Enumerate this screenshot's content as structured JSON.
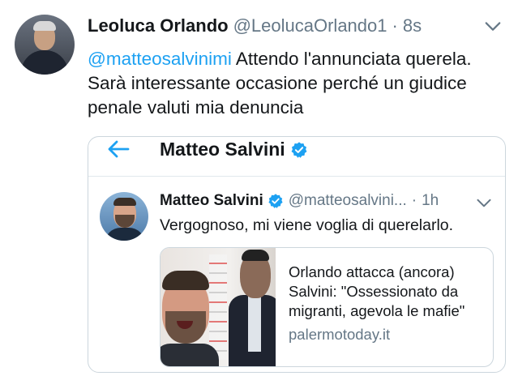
{
  "tweet": {
    "author_name": "Leoluca Orlando",
    "author_handle": "@LeolucaOrlando1",
    "separator": "·",
    "time": "8s",
    "mention": "@matteosalvinimi",
    "text": " Attendo l'annunciata querela. Sarà interessante occasione perché un giudice penale valuti mia denuncia"
  },
  "quoted_profile": {
    "title": "Matteo Salvini"
  },
  "quoted_tweet": {
    "author_name": "Matteo Salvini",
    "author_handle": "@matteosalvini...",
    "separator": "·",
    "time": "1h",
    "text": "Vergognoso, mi viene voglia di querelarlo."
  },
  "link_card": {
    "title": "Orlando attacca (ancora) Salvini: \"Ossessionato da migranti, agevola le mafie\"",
    "domain": "palermotoday.it"
  },
  "colors": {
    "accent": "#1da1f2",
    "secondary_text": "#657786",
    "border": "#ccd6dd"
  },
  "icons": [
    "chevron-down-icon",
    "back-arrow-icon",
    "verified-badge-icon"
  ]
}
